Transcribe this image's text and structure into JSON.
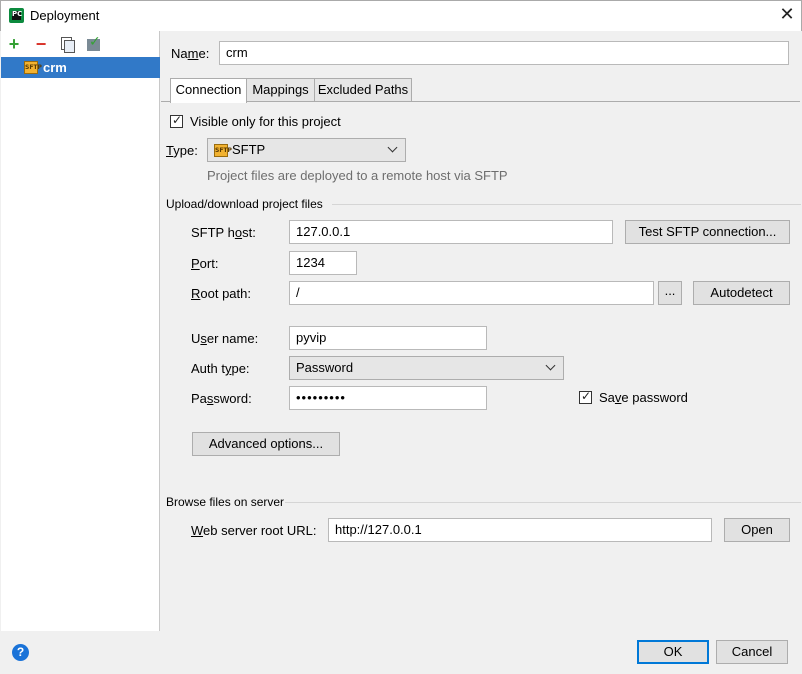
{
  "window": {
    "title": "Deployment",
    "close_glyph": "✕"
  },
  "toolbar": {
    "add_glyph": "+",
    "remove_glyph": "−",
    "icons": [
      "add-icon",
      "remove-icon",
      "copy-icon",
      "use-as-default-icon"
    ]
  },
  "tree": {
    "items": [
      {
        "label": "crm",
        "icon_text": "SFTP"
      }
    ]
  },
  "name": {
    "label_pre": "Na",
    "label_mnemonic": "m",
    "label_post": "e:",
    "value": "crm"
  },
  "tabs": [
    {
      "label": "Connection",
      "active": true
    },
    {
      "label": "Mappings",
      "active": false
    },
    {
      "label": "Excluded Paths",
      "active": false
    }
  ],
  "connection": {
    "visible_only": {
      "label": "Visible only for this project",
      "checked": true
    },
    "type": {
      "label_mnemonic": "T",
      "label_post": "ype:",
      "value": "SFTP",
      "icon_text": "SFTP"
    },
    "type_hint": "Project files are deployed to a remote host via SFTP",
    "upload_section_title": "Upload/download project files",
    "sftp_host": {
      "label_pre": "SFTP h",
      "label_mnemonic": "o",
      "label_post": "st:",
      "value": "127.0.0.1"
    },
    "test_button": "Test SFTP connection...",
    "port": {
      "label_mnemonic": "P",
      "label_post": "ort:",
      "value": "1234"
    },
    "root_path": {
      "label_mnemonic": "R",
      "label_post": "oot path:",
      "value": "/"
    },
    "browse_button": "...",
    "autodetect_button": "Autodetect",
    "user_name": {
      "label_pre": "U",
      "label_mnemonic": "s",
      "label_post": "er name:",
      "value": "pyvip"
    },
    "auth_type": {
      "label_pre": "Auth t",
      "label_mnemonic": "y",
      "label_post": "pe:",
      "value": "Password"
    },
    "password": {
      "label_pre": "Pa",
      "label_mnemonic": "s",
      "label_post": "sword:",
      "value": "•••••••••"
    },
    "save_password": {
      "label_pre": "Sa",
      "label_mnemonic": "v",
      "label_post": "e password",
      "checked": true
    },
    "advanced_button": "Advanced options...",
    "browse_section_title": "Browse files on server",
    "web_root": {
      "label_mnemonic": "W",
      "label_post": "eb server root URL:",
      "value": "http://127.0.0.1"
    },
    "open_button": "Open"
  },
  "footer": {
    "help_glyph": "?",
    "ok_button": "OK",
    "cancel_button": "Cancel"
  },
  "colors": {
    "selection": "#3179c8",
    "primary_border": "#0078d7",
    "add": "#35a135",
    "remove": "#d9342b"
  }
}
